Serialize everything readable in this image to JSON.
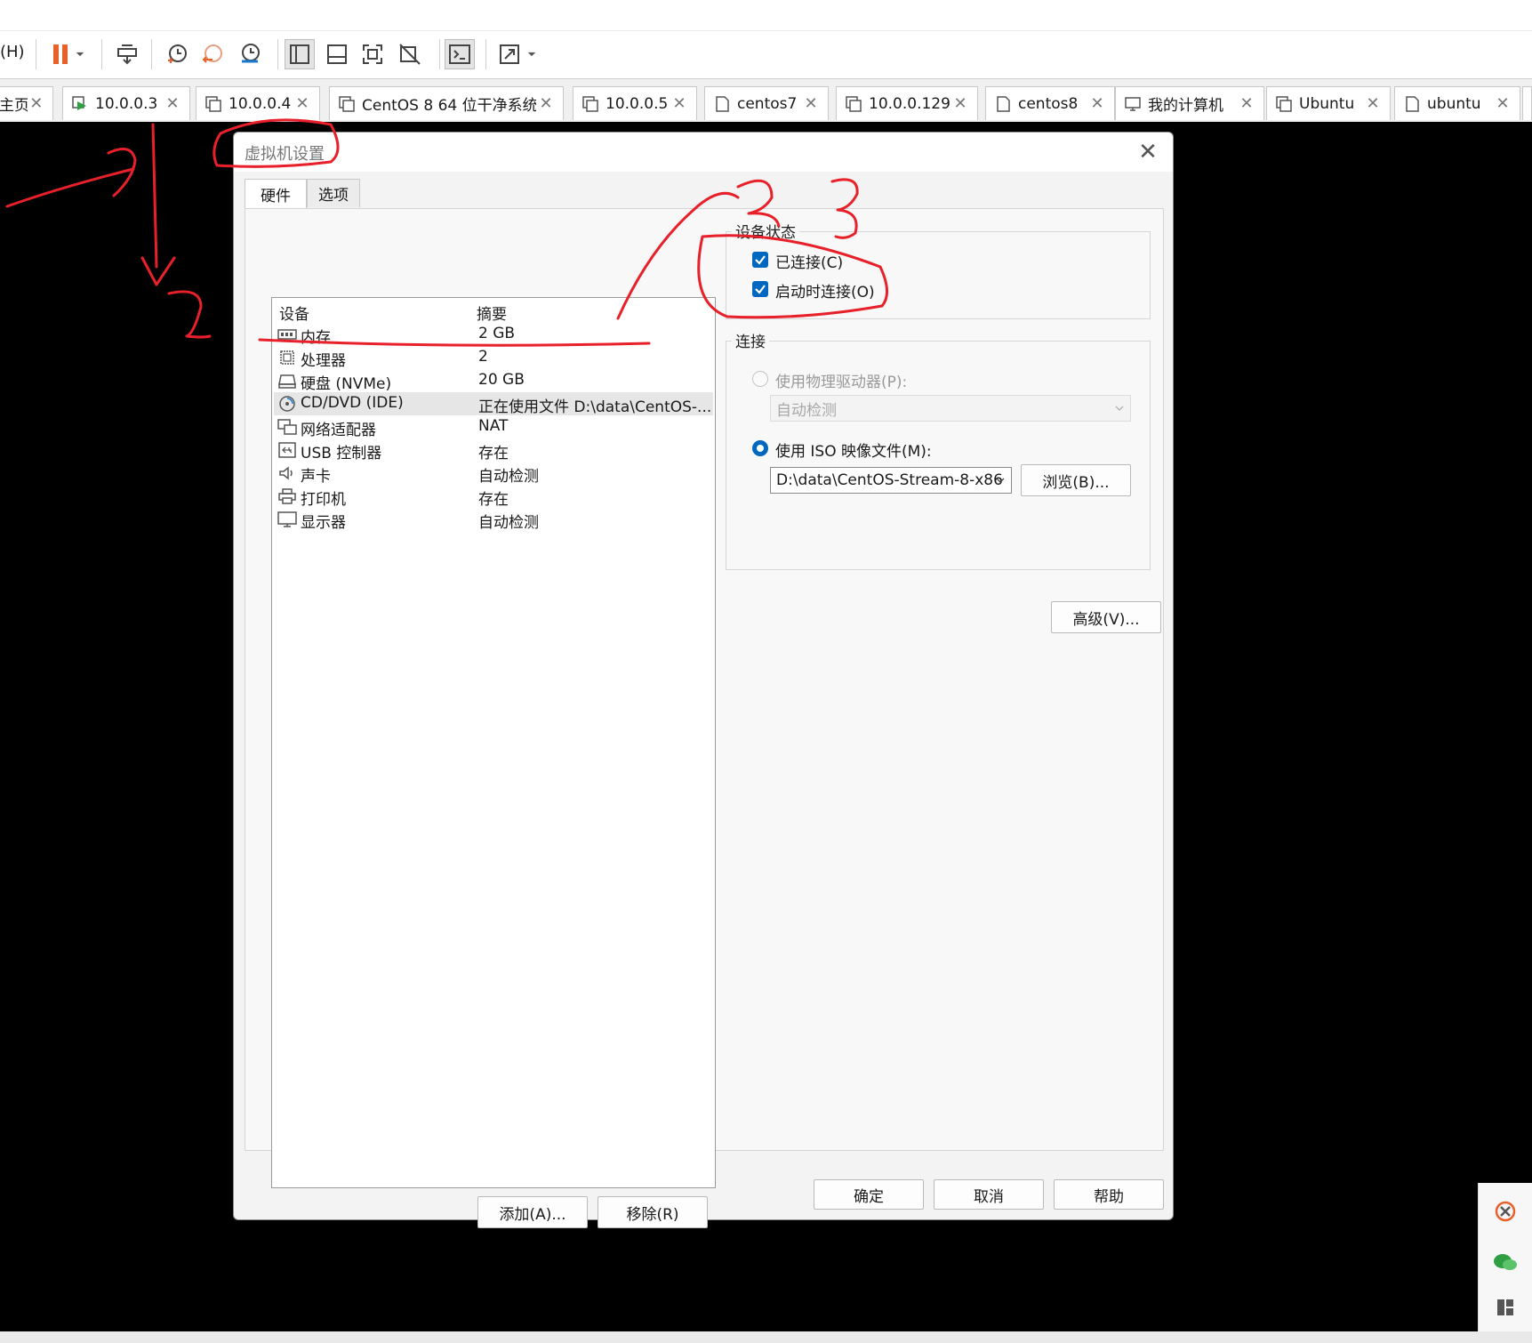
{
  "toolbar": {
    "menu_help": "(H)",
    "buttons": [
      "pause-button",
      "pause-dropdown",
      "send-ctrl-alt-del-button",
      "snapshot-take-button",
      "snapshot-revert-button",
      "snapshot-manager-button",
      "show-library-button",
      "thumbnail-bar-button",
      "fullscreen-button",
      "unity-button",
      "console-view-button",
      "stretch-guest-button"
    ]
  },
  "tabs": [
    {
      "label": "主页",
      "icon": "home-icon"
    },
    {
      "label": "10.0.0.3",
      "icon": "vm-running-icon"
    },
    {
      "label": "10.0.0.4",
      "icon": "vm-icon"
    },
    {
      "label": "CentOS 8 64 位干净系统",
      "icon": "vm-icon"
    },
    {
      "label": "10.0.0.5",
      "icon": "vm-icon"
    },
    {
      "label": "centos7",
      "icon": "vm-file-icon"
    },
    {
      "label": "10.0.0.129",
      "icon": "vm-icon"
    },
    {
      "label": "centos8",
      "icon": "vm-file-icon"
    },
    {
      "label": "我的计算机",
      "icon": "computer-icon"
    },
    {
      "label": "Ubuntu",
      "icon": "vm-icon"
    },
    {
      "label": "ubuntu",
      "icon": "vm-file-icon"
    }
  ],
  "dialog": {
    "title": "虚拟机设置",
    "tabs": [
      "硬件",
      "选项"
    ],
    "device_list": {
      "headers": {
        "device": "设备",
        "summary": "摘要"
      },
      "rows": [
        {
          "name": "内存",
          "summary": "2 GB",
          "icon": "memory-icon"
        },
        {
          "name": "处理器",
          "summary": "2",
          "icon": "cpu-icon"
        },
        {
          "name": "硬盘 (NVMe)",
          "summary": "20 GB",
          "icon": "hard-disk-icon"
        },
        {
          "name": "CD/DVD (IDE)",
          "summary": "正在使用文件 D:\\data\\CentOS-...",
          "icon": "cd-dvd-icon",
          "selected": true
        },
        {
          "name": "网络适配器",
          "summary": "NAT",
          "icon": "network-adapter-icon"
        },
        {
          "name": "USB 控制器",
          "summary": "存在",
          "icon": "usb-icon"
        },
        {
          "name": "声卡",
          "summary": "自动检测",
          "icon": "sound-card-icon"
        },
        {
          "name": "打印机",
          "summary": "存在",
          "icon": "printer-icon"
        },
        {
          "name": "显示器",
          "summary": "自动检测",
          "icon": "display-icon"
        }
      ]
    },
    "add_button": "添加(A)...",
    "remove_button": "移除(R)",
    "device_status": {
      "title": "设备状态",
      "connected": {
        "label": "已连接(C)",
        "checked": true
      },
      "connect_at_power_on": {
        "label": "启动时连接(O)",
        "checked": true
      }
    },
    "connection": {
      "title": "连接",
      "physical_drive": {
        "label": "使用物理驱动器(P):",
        "selected": false,
        "value": "自动检测"
      },
      "iso_image": {
        "label": "使用 ISO 映像文件(M):",
        "selected": true,
        "value": "D:\\data\\CentOS-Stream-8-x86"
      },
      "browse_button": "浏览(B)..."
    },
    "advanced_button": "高级(V)...",
    "ok_button": "确定",
    "cancel_button": "取消",
    "help_button": "帮助"
  },
  "colors": {
    "accent": "#0067c0",
    "annotation": "#e8202a",
    "pause": "#e8602a",
    "vm_background": "#000000"
  }
}
